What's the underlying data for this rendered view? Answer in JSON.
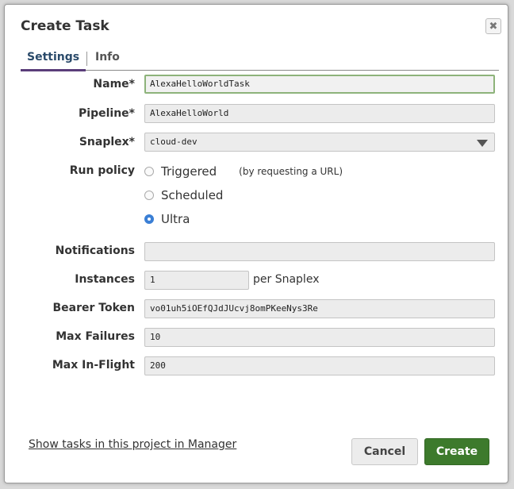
{
  "dialog": {
    "title": "Create Task",
    "close_glyph": "✖"
  },
  "tabs": [
    {
      "label": "Settings",
      "active": true
    },
    {
      "label": "Info",
      "active": false
    }
  ],
  "form": {
    "name": {
      "label": "Name*",
      "value": "AlexaHelloWorldTask"
    },
    "pipeline": {
      "label": "Pipeline*",
      "value": "AlexaHelloWorld"
    },
    "snaplex": {
      "label": "Snaplex*",
      "value": "cloud-dev"
    },
    "run_policy": {
      "label": "Run policy",
      "options": [
        {
          "label": "Triggered",
          "hint": "(by requesting a URL)",
          "checked": false
        },
        {
          "label": "Scheduled",
          "hint": "",
          "checked": false
        },
        {
          "label": "Ultra",
          "hint": "",
          "checked": true
        }
      ]
    },
    "notifications": {
      "label": "Notifications",
      "value": ""
    },
    "instances": {
      "label": "Instances",
      "value": "1",
      "suffix": "per Snaplex"
    },
    "bearer_token": {
      "label": "Bearer Token",
      "value": "vo01uh5iOEfQJdJUcvj8omPKeeNys3Re"
    },
    "max_failures": {
      "label": "Max Failures",
      "value": "10"
    },
    "max_in_flight": {
      "label": "Max In-Flight",
      "value": "200"
    }
  },
  "footer": {
    "link": "Show tasks in this project in Manager",
    "cancel": "Cancel",
    "create": "Create"
  },
  "colors": {
    "create_button": "#3d7a2c",
    "focus_border": "#8db37a",
    "radio_checked": "#3a7fd5",
    "tab_underline": "#5a3d7a"
  }
}
